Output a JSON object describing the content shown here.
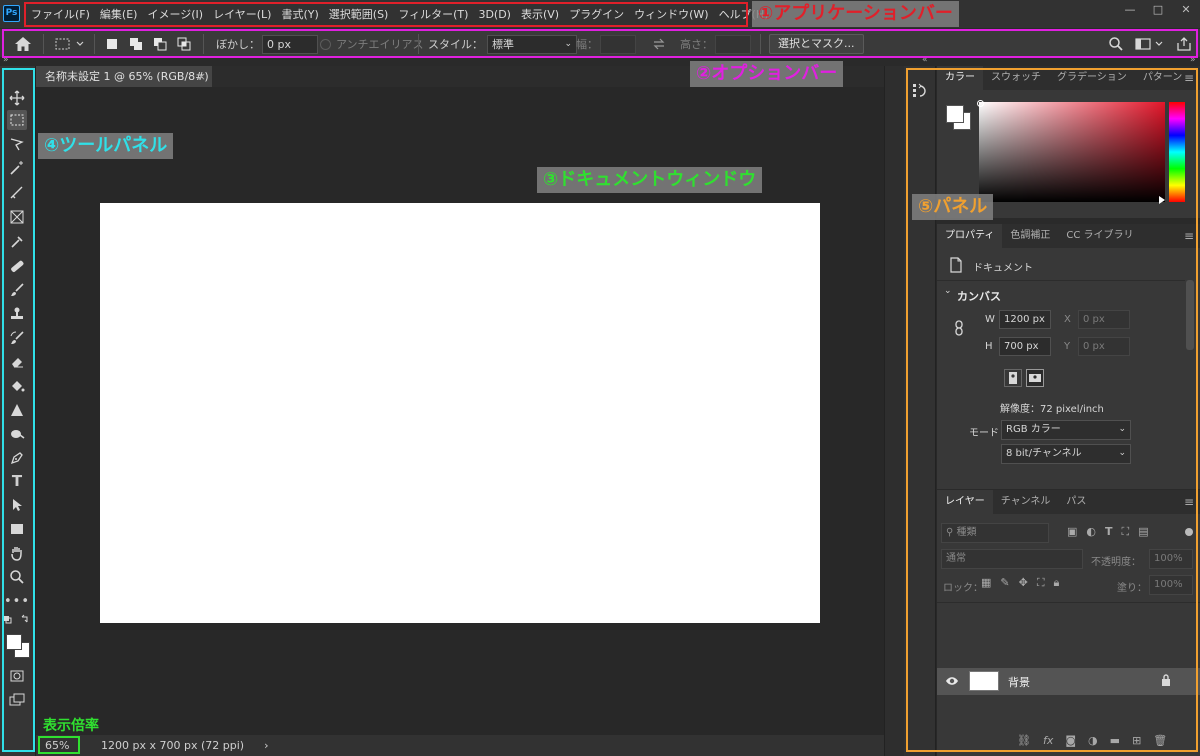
{
  "app": {
    "logo_text": "Ps",
    "menus": [
      "ファイル(F)",
      "編集(E)",
      "イメージ(I)",
      "レイヤー(L)",
      "書式(Y)",
      "選択範囲(S)",
      "フィルター(T)",
      "3D(D)",
      "表示(V)",
      "プラグイン",
      "ウィンドウ(W)",
      "ヘルプ(H)"
    ],
    "window_controls": [
      "—",
      "□",
      "✕"
    ]
  },
  "options": {
    "feather_label": "ぼかし：",
    "feather_value": "0 px",
    "antialias_label": "アンチエイリアス",
    "style_label": "スタイル：",
    "style_value": "標準",
    "width_label": "幅：",
    "height_label": "高さ：",
    "select_mask_label": "選択とマスク..."
  },
  "document": {
    "tab_title": "名称未設定 1 @ 65% (RGB/8#)",
    "close_glyph": "×",
    "zoom": "65%",
    "doc_info": "1200 px x 700 px (72 ppi)",
    "status_arrow": "›"
  },
  "color_panel": {
    "tabs": [
      "カラー",
      "スウォッチ",
      "グラデーション",
      "パターン"
    ],
    "spectrum_colors": [
      "#ff0000",
      "#ff00ff",
      "#0000ff",
      "#00ffff",
      "#00ff00",
      "#ffff00",
      "#ff0000"
    ]
  },
  "properties_panel": {
    "tabs": [
      "プロパティ",
      "色調補正",
      "CC ライブラリ"
    ],
    "doc_label": "ドキュメント",
    "section": "カンバス",
    "w_label": "W",
    "w_value": "1200 px",
    "h_label": "H",
    "h_value": "700 px",
    "x_label": "X",
    "x_value": "0 px",
    "y_label": "Y",
    "y_value": "0 px",
    "resolution": "解像度：72 pixel/inch",
    "mode_label": "モード",
    "mode_value": "RGB カラー",
    "bitdepth_value": "8 bit/チャンネル"
  },
  "layers_panel": {
    "tabs": [
      "レイヤー",
      "チャンネル",
      "パス"
    ],
    "filter_placeholder": "種類",
    "blend_mode": "通常",
    "opacity_label": "不透明度：",
    "opacity_value": "100%",
    "lock_label": "ロック：",
    "fill_label": "塗り：",
    "fill_value": "100%",
    "layer_name": "背景",
    "fx_label": "fx"
  },
  "annotations": {
    "app_bar": "①アプリケーションバー",
    "option_bar": "②オプションバー",
    "doc_window": "③ドキュメントウィンドウ",
    "tool_panel": "④ツールパネル",
    "panel": "⑤パネル",
    "zoom_label": "表示倍率",
    "colors": {
      "red": "#e0202a",
      "magenta": "#e020e0",
      "cyan": "#30e0e8",
      "orange": "#f0a030",
      "green": "#30e030"
    }
  }
}
